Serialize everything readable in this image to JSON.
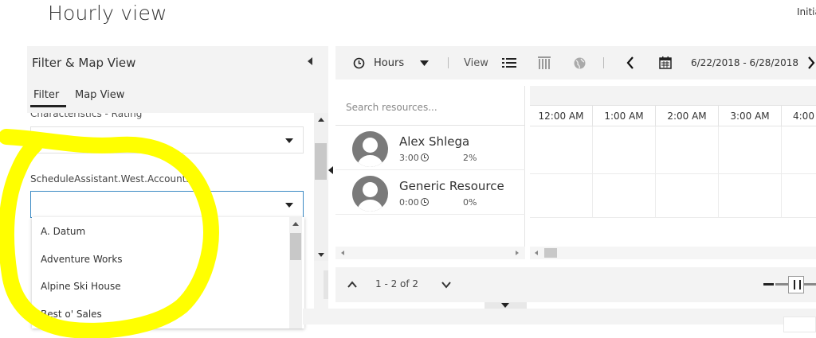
{
  "page": {
    "title": "Hourly view",
    "user_initials_cut": "Initia"
  },
  "filter_panel": {
    "title": "Filter & Map View",
    "tabs": [
      {
        "label": "Filter",
        "active": true
      },
      {
        "label": "Map View",
        "active": false
      }
    ],
    "field1_label_cut": "Characteristics - Rating",
    "field2_label": "ScheduleAssistant.West.Accounts",
    "dropdown_options": [
      "A. Datum",
      "Adventure Works",
      "Alpine Ski House",
      "Best o' Sales"
    ]
  },
  "toolbar": {
    "hours_label": "Hours",
    "view_label": "View",
    "date_range": "6/22/2018 - 6/28/2018",
    "icons": [
      "clock-icon",
      "caret-down-icon",
      "list-view-icon",
      "gantt-view-icon",
      "globe-icon",
      "chevron-left-icon",
      "calendar-icon",
      "chevron-right-icon"
    ]
  },
  "resources": {
    "search_placeholder": "Search resources...",
    "items": [
      {
        "name": "Alex Shlega",
        "hours": "3:00",
        "percent": "2%"
      },
      {
        "name": "Generic Resource",
        "hours": "0:00",
        "percent": "0%"
      }
    ]
  },
  "grid": {
    "hours": [
      "12:00 AM",
      "1:00 AM",
      "2:00 AM",
      "3:00 AM",
      "4:00"
    ]
  },
  "pager": {
    "text": "1 - 2 of 2"
  },
  "annotation": {
    "color": "#ffff00"
  }
}
